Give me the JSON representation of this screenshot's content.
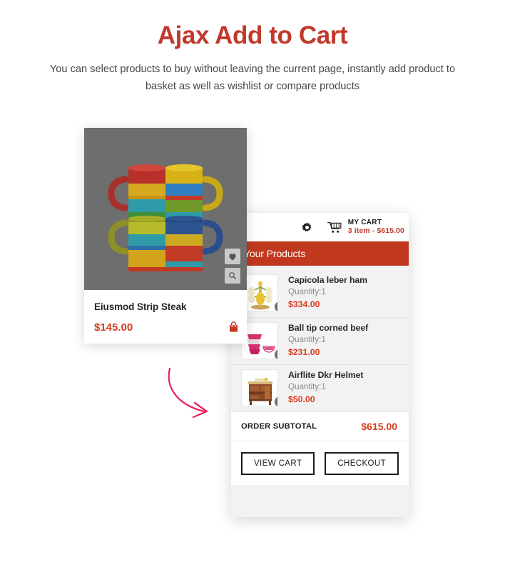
{
  "header": {
    "title": "Ajax Add to Cart",
    "subtitle": "You can select products to buy without leaving the current page, instantly add product to basket as well as wishlist or compare products",
    "title_color": "#c0392b"
  },
  "product_card": {
    "name": "Eiusmod Strip Steak",
    "price": "$145.00",
    "price_color": "#d93b1e",
    "image_alt": "stacked colorful ceramic mugs",
    "image_bg": "#6e6e6e",
    "actions": [
      {
        "name": "wishlist-button",
        "icon": "heart-icon"
      },
      {
        "name": "quick-view-button",
        "icon": "search-icon"
      }
    ],
    "add_to_cart_icon": "shopping-bag-icon"
  },
  "mini_cart": {
    "topbar": {
      "settings_icon": "gear-icon",
      "cart_icon": "cart-icon",
      "title": "MY CART",
      "summary": "3 item - $615.00",
      "summary_color": "#c0392b"
    },
    "banner": {
      "label": "Your Products",
      "bg_color": "#c0391f"
    },
    "items": [
      {
        "name": "Capicola leber ham",
        "quantity_label": "Quantity:1",
        "price": "$334.00",
        "thumb_alt": "yellow mug tree stand",
        "remove_icon": "remove-circle-icon"
      },
      {
        "name": "Ball tip corned beef",
        "quantity_label": "Quantity:1",
        "price": "$231.00",
        "thumb_alt": "pink patterned ceramic bowls",
        "remove_icon": "remove-circle-icon"
      },
      {
        "name": "Airflite Dkr Helmet",
        "quantity_label": "Quantity:1",
        "price": "$50.00",
        "thumb_alt": "wooden kitchen serving cart",
        "remove_icon": "remove-circle-icon"
      }
    ],
    "subtotal": {
      "label": "ORDER SUBTOTAL",
      "value": "$615.00",
      "value_color": "#d93b1e"
    },
    "actions": {
      "view_cart_label": "VIEW CART",
      "checkout_label": "CHECKOUT"
    }
  },
  "annotation": {
    "arrow_icon": "curved-arrow-icon",
    "arrow_color": "#e8245c"
  }
}
